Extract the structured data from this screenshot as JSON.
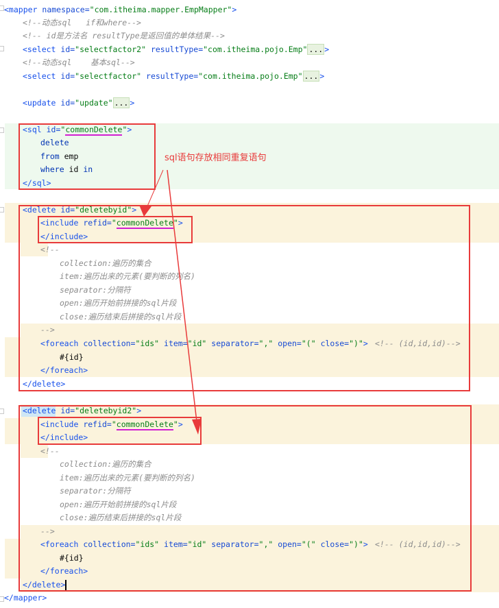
{
  "lines": {
    "mapper_open_tag": "<mapper",
    "mapper_ns_attr": " namespace=",
    "mapper_ns_val": "\"com.itheima.mapper.EmpMapper\"",
    "mapper_open_end": ">",
    "cmt1": "<!--动态sql   if和where-->",
    "cmt2": "<!-- id是方法名 resultType是返回值的单体结果-->",
    "sel1_tag": "<select",
    "sel1_id_attr": " id=",
    "sel1_id_val": "\"selectfactor2\"",
    "sel1_rt_attr": " resultType=",
    "sel1_rt_val": "\"com.itheima.pojo.Emp\"",
    "ellipsis": "...",
    "close_gt": ">",
    "cmt3": "<!--动态sql    基本sql-->",
    "sel2_tag": "<select",
    "sel2_id_attr": " id=",
    "sel2_id_val": "\"selectfactor\"",
    "sel2_rt_attr": " resultType=",
    "sel2_rt_val": "\"com.itheima.pojo.Emp\"",
    "upd_tag": "<update",
    "upd_id_attr": " id=",
    "upd_id_val": "\"update\"",
    "sql_tag": "<sql",
    "sql_id_attr": " id=",
    "sql_id_val_q1": "\"",
    "sql_id_val": "commonDelete",
    "sql_id_val_q2": "\"",
    "sql_body1": "delete",
    "sql_body2_kw": "from",
    "sql_body2_txt": " emp",
    "sql_body3_kw1": "where",
    "sql_body3_txt": " id ",
    "sql_body3_kw2": "in",
    "sql_close": "</sql>",
    "del1_tag": "<delete",
    "del1_id_attr": " id=",
    "del1_id_val": "\"deletebyid\"",
    "inc_tag": "<include",
    "inc_refid_attr": " refid=",
    "inc_q1": "\"",
    "inc_val": "commonDelete",
    "inc_q2": "\"",
    "inc_close": "</include>",
    "cmt_open": "<!--",
    "c_collection_k": "collection:",
    "c_collection_v": "遍历的集合",
    "c_item_k": "item:",
    "c_item_v": "遍历出来的元素(要判断的列名)",
    "c_sep_k": "separator:",
    "c_sep_v": "分隔符",
    "c_open_k": "open:",
    "c_open_v": "遍历开始前拼接的sql片段",
    "c_close_k": "close:",
    "c_close_v": "遍历结束后拼接的sql片段",
    "cmt_close": "-->",
    "fe_tag": "<foreach",
    "fe_coll_attr": " collection=",
    "fe_coll_val": "\"ids\"",
    "fe_item_attr": " item=",
    "fe_item_val": "\"id\"",
    "fe_sep_attr": " separator=",
    "fe_sep_val": "\",\"",
    "fe_open_attr": " open=",
    "fe_open_val": "\"(\"",
    "fe_close_attr": " close=",
    "fe_close_val": "\")\"",
    "fe_trail_cmt": "<!-- (id,id,id)-->",
    "fe_body": "#{id}",
    "fe_close": "</foreach>",
    "del_close": "</delete>",
    "del2_tag": "<delete",
    "del2_id_attr": " id=",
    "del2_id_val": "\"deletebyid2\"",
    "mapper_close": "</mapper>"
  },
  "annotation": {
    "note": "sql语句存放相同重复语句"
  },
  "colors": {
    "accent_red": "#e83a3a",
    "underline_magenta": "#d11fd1",
    "band_green": "#eef9ee",
    "band_yellow": "#fbf3dc"
  }
}
